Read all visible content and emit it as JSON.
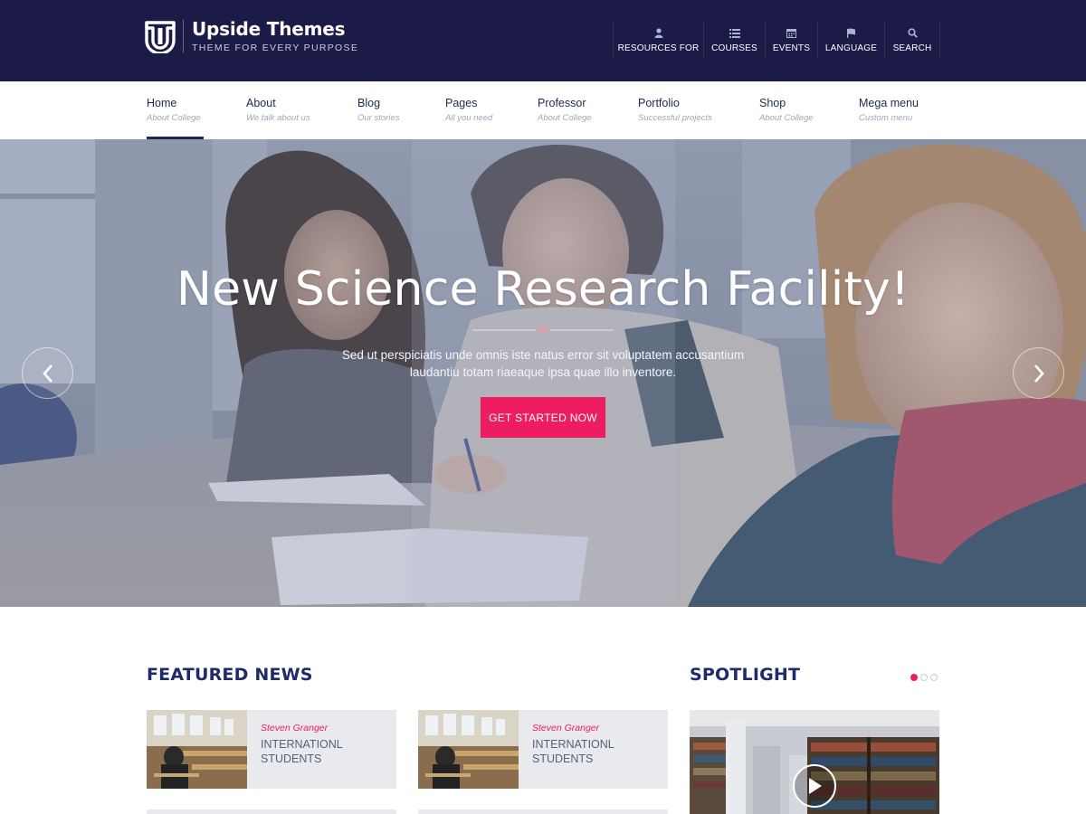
{
  "brand": {
    "name": "Upside Themes",
    "tagline": "THEME FOR EVERY PURPOSE"
  },
  "top_menu": [
    {
      "label": "RESOURCES FOR",
      "icon": "user-icon"
    },
    {
      "label": "COURSES",
      "icon": "list-icon"
    },
    {
      "label": "EVENTS",
      "icon": "calendar-icon"
    },
    {
      "label": "LANGUAGE",
      "icon": "flag-icon"
    },
    {
      "label": "SEARCH",
      "icon": "search-icon"
    }
  ],
  "main_nav": [
    {
      "label": "Home",
      "sub": "About College",
      "active": true
    },
    {
      "label": "About",
      "sub": "We talk about us"
    },
    {
      "label": "Blog",
      "sub": "Our stories"
    },
    {
      "label": "Pages",
      "sub": "All you need"
    },
    {
      "label": "Professor",
      "sub": "About College"
    },
    {
      "label": "Portfolio",
      "sub": "Successful projects"
    },
    {
      "label": "Shop",
      "sub": "About College"
    },
    {
      "label": "Mega menu",
      "sub": "Custom menu"
    }
  ],
  "hero": {
    "title": "New Science Research Facility!",
    "text": "Sed ut perspiciatis unde omnis iste natus error sit voluptatem accusantium laudantiu totam riaeaque ipsa quae illo inventore.",
    "cta": "GET STARTED NOW"
  },
  "featured": {
    "title": "FEATURED NEWS",
    "items": [
      {
        "author": "Steven Granger",
        "title": "INTERNATIONL STUDENTS"
      },
      {
        "author": "Steven Granger",
        "title": "INTERNATIONL STUDENTS"
      }
    ]
  },
  "spotlight": {
    "title": "SPOTLIGHT",
    "slides": 3,
    "active_slide": 1
  },
  "colors": {
    "header_bg": "#1c1b47",
    "accent": "#ee1d62",
    "heading": "#1e2a6a",
    "card_bg": "#e8eaee"
  }
}
